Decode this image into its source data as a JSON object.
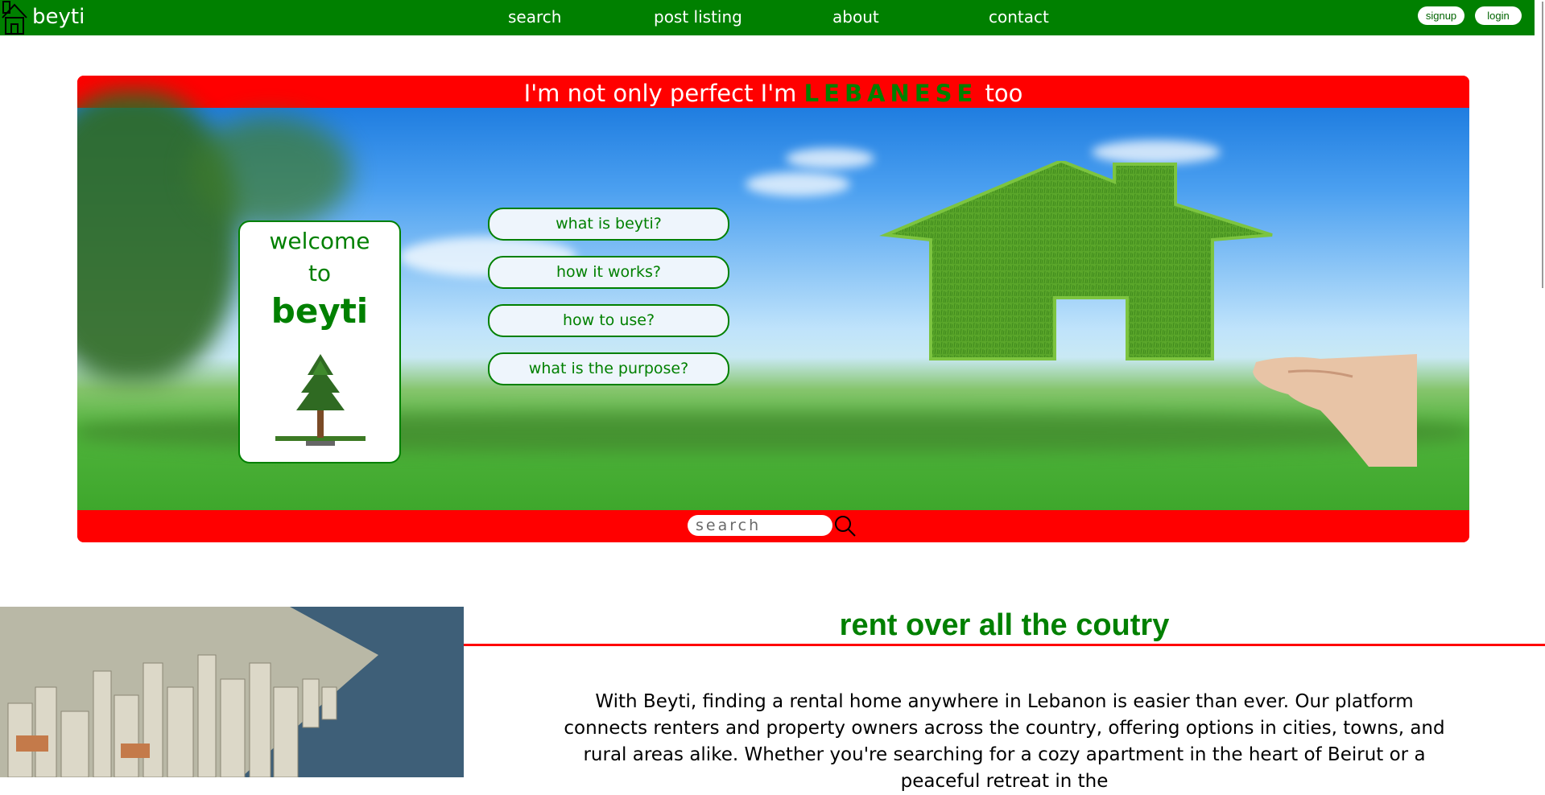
{
  "nav": {
    "logo_text": "beyti",
    "links": [
      "search",
      "post listing",
      "about",
      "contact"
    ],
    "signup_label": "signup",
    "login_label": "login"
  },
  "hero": {
    "slogan_start": "I'm not only perfect I'm",
    "slogan_highlight": "LEBANESE",
    "slogan_end": "too",
    "welcome": {
      "line1": "welcome",
      "line2": "to",
      "brand": "beyti"
    },
    "info_buttons": [
      "what is beyti?",
      "how it works?",
      "how to use?",
      "what is the purpose?"
    ],
    "search_placeholder": "search"
  },
  "section": {
    "title": "rent over all the coutry",
    "body": "With Beyti, finding a rental home anywhere in Lebanon is easier than ever. Our platform connects renters and property owners across the country, offering options in cities, towns, and rural areas alike. Whether you're searching for a cozy apartment in the heart of Beirut or a peaceful retreat in the"
  },
  "colors": {
    "brand_green": "#008000",
    "accent_red": "#ff0000",
    "button_fill": "#eef5fc"
  }
}
